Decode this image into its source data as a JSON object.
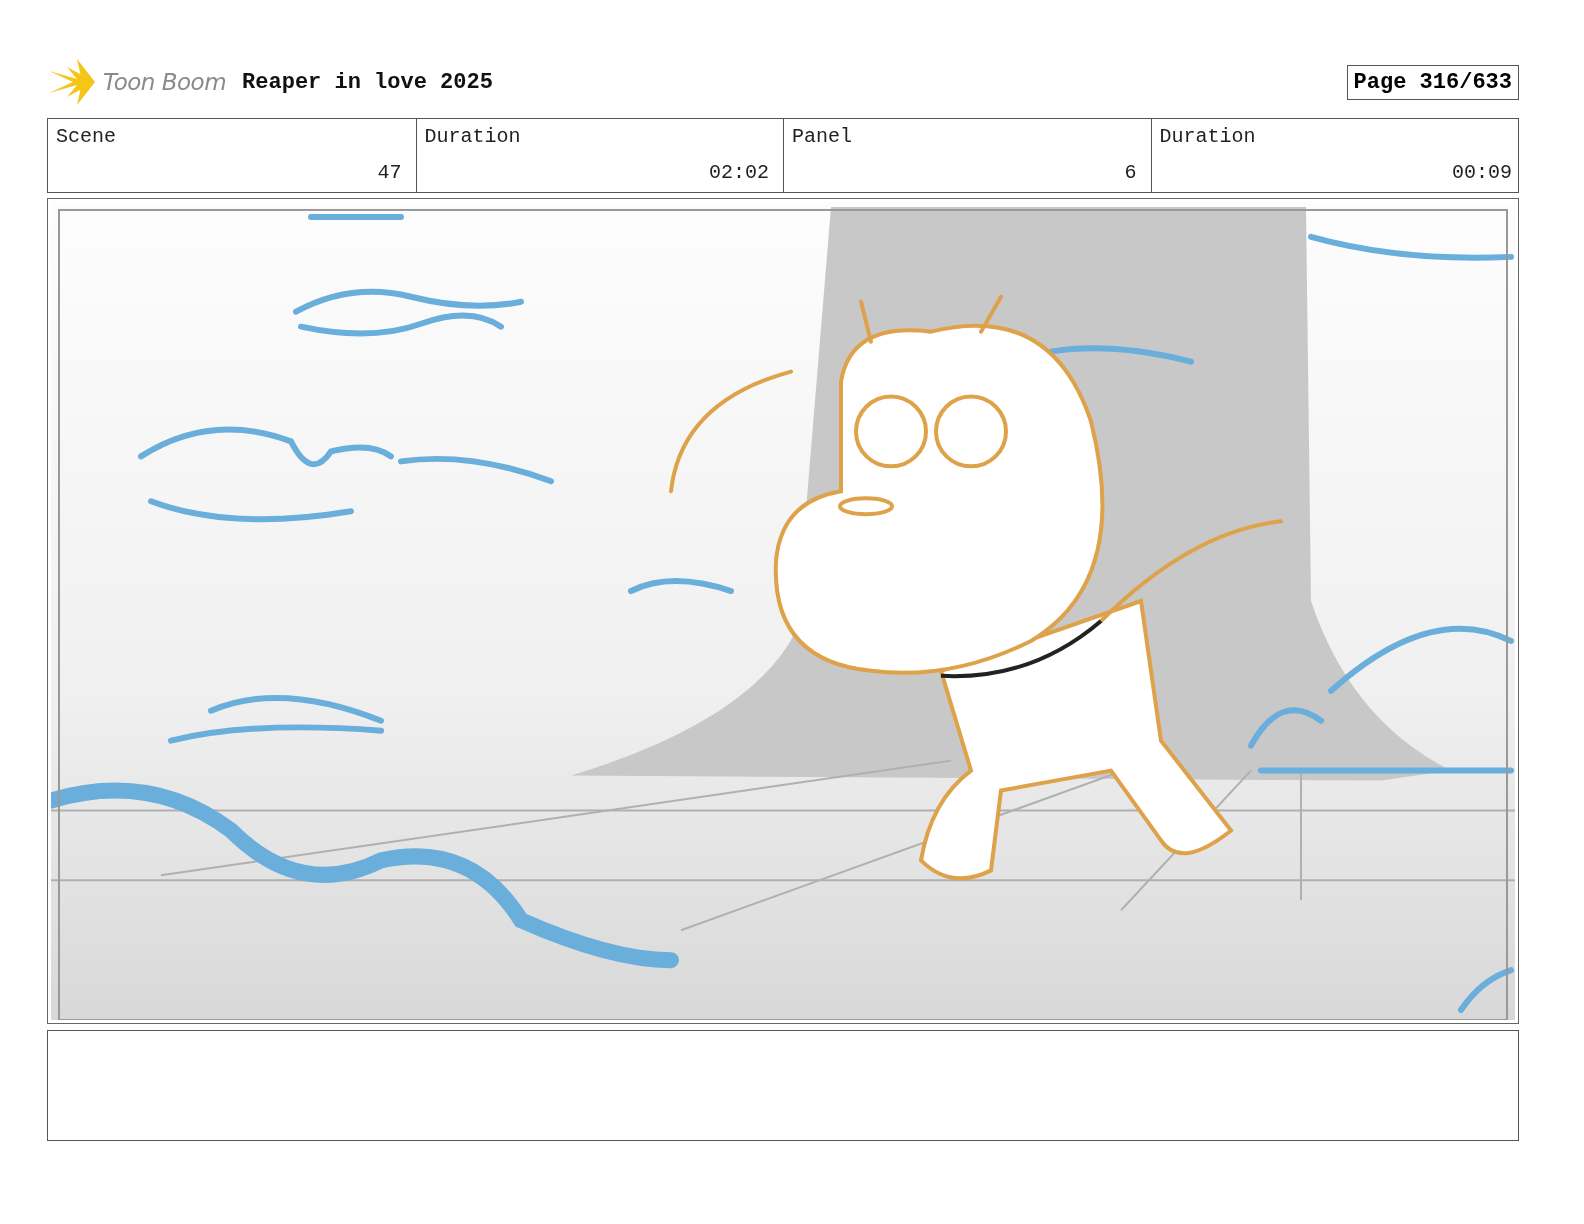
{
  "header": {
    "logo_text": "Toon Boom",
    "project_title": "Reaper in love 2025",
    "page": "Page 316/633"
  },
  "info_cells": [
    {
      "label": "Scene",
      "value": "47"
    },
    {
      "label": "Duration",
      "value": "02:02"
    },
    {
      "label": "Panel",
      "value": "6"
    },
    {
      "label": "Duration",
      "value": "00:09"
    }
  ]
}
